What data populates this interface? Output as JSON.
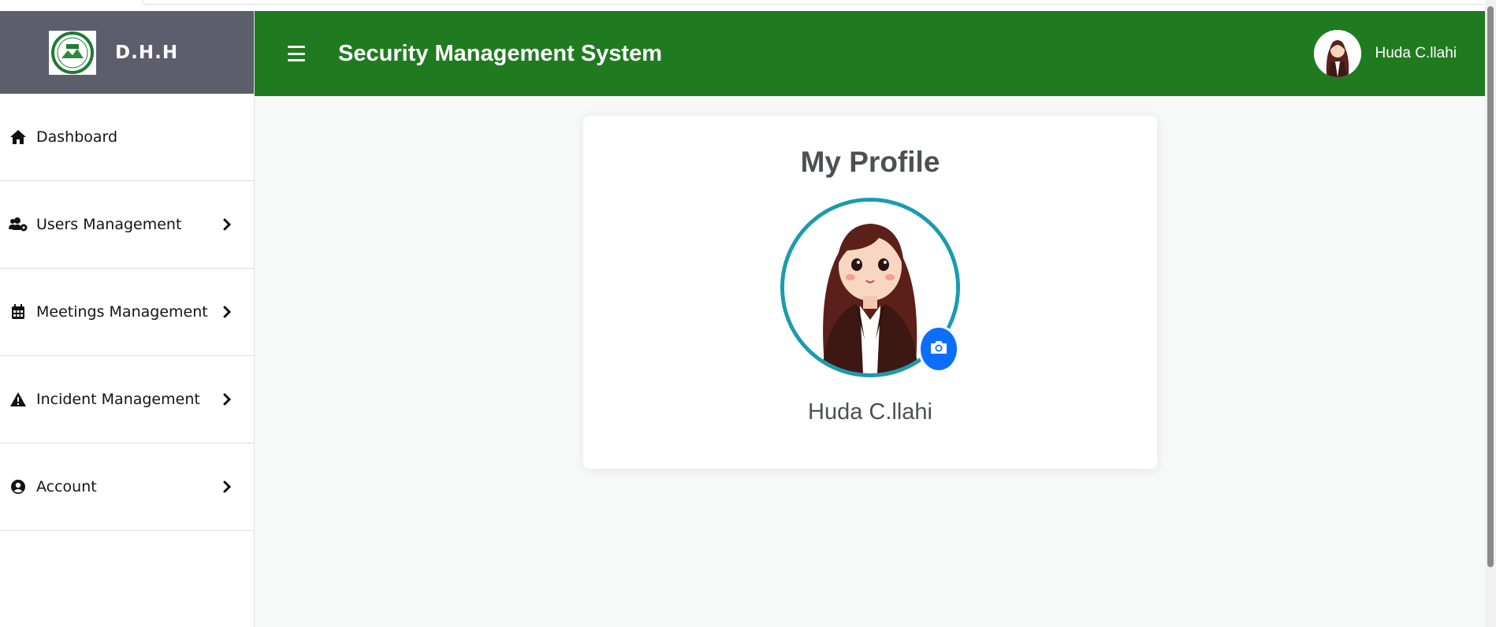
{
  "brand": {
    "name": "D.H.H"
  },
  "sidebar": {
    "items": [
      {
        "label": "Dashboard",
        "icon": "home-icon"
      },
      {
        "label": "Users Management",
        "icon": "users-cog-icon"
      },
      {
        "label": "Meetings Management",
        "icon": "calendar-icon"
      },
      {
        "label": "Incident Management",
        "icon": "warning-icon"
      },
      {
        "label": "Account",
        "icon": "user-circle-icon"
      }
    ]
  },
  "header": {
    "title": "Security Management System",
    "username": "Huda C.llahi"
  },
  "profile": {
    "title": "My Profile",
    "name": "Huda C.llahi"
  },
  "colors": {
    "header_bg": "#207a20",
    "brand_bg": "#5c5e6c",
    "avatar_ring": "#1b9bae",
    "camera_button": "#0d6efd"
  }
}
